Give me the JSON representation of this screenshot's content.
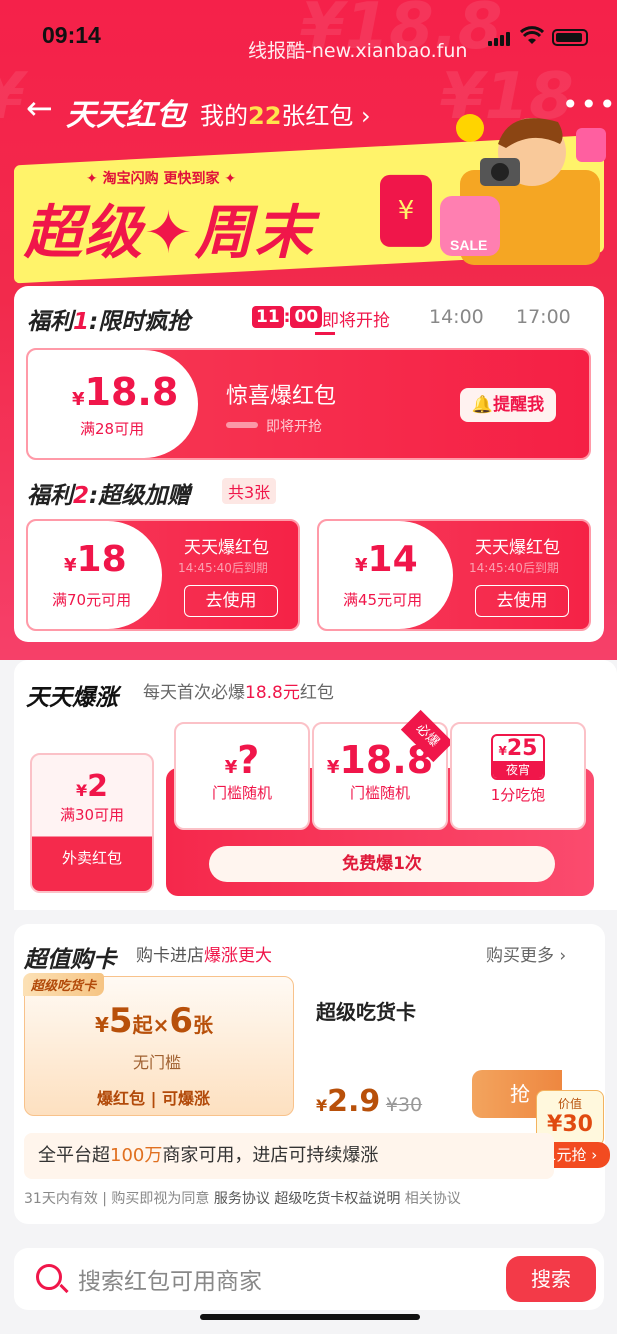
{
  "status": {
    "time": "09:14",
    "watermark": "线报酷-new.xianbao.fun"
  },
  "nav": {
    "back": "←",
    "title": "天天红包",
    "sub_prefix": "我的",
    "count": "22",
    "sub_suffix": "张红包 ›",
    "more": "•••"
  },
  "banner": {
    "tag": "✦ 淘宝闪购  更快到家 ✦",
    "title": "超级✦周末",
    "env": "¥",
    "sale": "SALE"
  },
  "welfare1": {
    "title_a": "福利",
    "num": "1",
    "title_b": ":限时疯抢",
    "hour": "11",
    "minute": "00",
    "status": "即将开抢",
    "slots": [
      "14:00",
      "17:00"
    ],
    "coupon": {
      "currency": "¥",
      "amount": "18.8",
      "condition": "满28可用",
      "name": "惊喜爆红包",
      "soon": "即将开抢",
      "button": "提醒我"
    }
  },
  "welfare2": {
    "title_a": "福利",
    "num": "2",
    "title_b": ":超级加赠",
    "count": "共3张",
    "coupons": [
      {
        "currency": "¥",
        "amount": "18",
        "condition": "满70元可用",
        "name": "天天爆红包",
        "expiry": "14:45:40后到期",
        "button": "去使用"
      },
      {
        "currency": "¥",
        "amount": "14",
        "condition": "满45元可用",
        "name": "天天爆红包",
        "expiry": "14:45:40后到期",
        "button": "去使用"
      }
    ]
  },
  "daily": {
    "title": "天天爆涨",
    "sub_a": "每天首次必爆",
    "sub_b": "18.8元",
    "sub_c": "红包",
    "small": {
      "currency": "¥",
      "amount": "2",
      "condition": "满30可用",
      "label": "外卖红包"
    },
    "cards": [
      {
        "currency": "¥",
        "amount": "?",
        "label": "门槛随机"
      },
      {
        "currency": "¥",
        "amount": "18.8",
        "label": "门槛随机"
      },
      {
        "currency": "¥",
        "amount": "25",
        "tag": "夜宵",
        "label": "1分吃饱"
      }
    ],
    "badge": "必爆",
    "button": "免费爆1次"
  },
  "supercard": {
    "title": "超值购卡",
    "sub_a": "购卡进店",
    "sub_b": "爆涨更大",
    "more": "购买更多 ›",
    "tile": {
      "tag": "超级吃货卡",
      "prefix": "¥",
      "a": "5",
      "mid": "起×",
      "b": "6",
      "unit": "张",
      "no_threshold": "无门槛",
      "features": "爆红包 | 可爆涨"
    },
    "name": "超级吃货卡",
    "price_currency": "¥",
    "price": "2.9",
    "original": "¥30",
    "grab": "抢",
    "value_label": "价值",
    "value": "¥30",
    "value_tag": "超级吃货卡",
    "promo": "0.1元抢 ›",
    "note_a": "全平台超",
    "note_b": "100万",
    "note_c": "商家可用，进店可持续爆涨",
    "footer_a": "31天内有效 | 购买即视为同意 ",
    "footer_b": "服务协议 超级吃货卡权益说明",
    "footer_c": " 相关协议"
  },
  "search": {
    "placeholder": "搜索红包可用商家",
    "button": "搜索"
  }
}
